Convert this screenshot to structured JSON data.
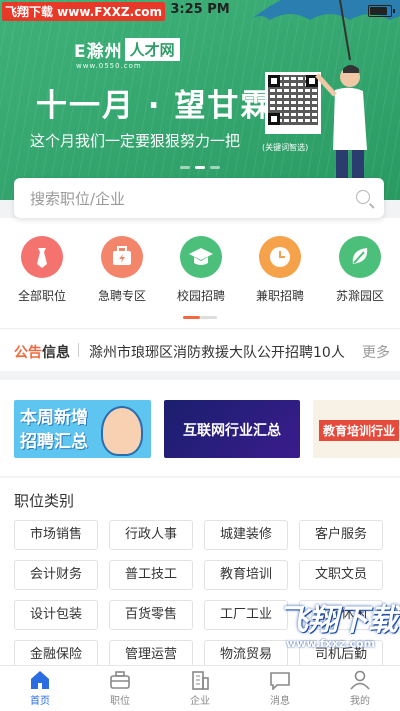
{
  "status_bar": {
    "watermark": "飞翔下载 www.FXXZ.com",
    "time": "3:25 PM"
  },
  "banner": {
    "logo_main": "E滁州",
    "logo_box": "人才网",
    "logo_sub": "www.0550.com",
    "headline": "十一月 · 望甘霖",
    "subline": "这个月我们一定要狠狠努力一把",
    "qr_caption": "(关键词智选)",
    "active_dot": 1
  },
  "search": {
    "placeholder": "搜索职位/企业"
  },
  "quick_nav": [
    {
      "label": "全部职位",
      "icon": "tie-icon",
      "color": "#f5736f"
    },
    {
      "label": "急聘专区",
      "icon": "briefcase-icon",
      "color": "#f3866a"
    },
    {
      "label": "校园招聘",
      "icon": "graduation-cap-icon",
      "color": "#4cc07a"
    },
    {
      "label": "兼职招聘",
      "icon": "clock-icon",
      "color": "#f6a24b"
    },
    {
      "label": "苏滁园区",
      "icon": "leaf-icon",
      "color": "#4cc07a"
    }
  ],
  "notice": {
    "tag_a": "公告",
    "tag_b": "信息",
    "text": "滁州市琅琊区消防救援大队公开招聘10人",
    "more": "更多"
  },
  "promos": [
    {
      "text_line1": "本周新增",
      "text_line2": "招聘汇总"
    },
    {
      "text": "互联网行业汇总"
    },
    {
      "text": "教育培训行业"
    }
  ],
  "categories": {
    "title": "职位类别",
    "items": [
      "市场销售",
      "行政人事",
      "城建装修",
      "客户服务",
      "会计财务",
      "普工技工",
      "教育培训",
      "文职文员",
      "设计包装",
      "百货零售",
      "工厂工业",
      "餐饮休闲",
      "金融保险",
      "管理运营",
      "物流贸易",
      "司机后勤"
    ]
  },
  "tabbar": [
    {
      "label": "首页",
      "icon": "home-icon",
      "active": true
    },
    {
      "label": "职位",
      "icon": "briefcase-icon",
      "active": false
    },
    {
      "label": "企业",
      "icon": "building-icon",
      "active": false
    },
    {
      "label": "消息",
      "icon": "message-icon",
      "active": false
    },
    {
      "label": "我的",
      "icon": "user-icon",
      "active": false
    }
  ],
  "corner_watermark": {
    "big": "飞翔下载",
    "url": "www.fxxz.com"
  }
}
